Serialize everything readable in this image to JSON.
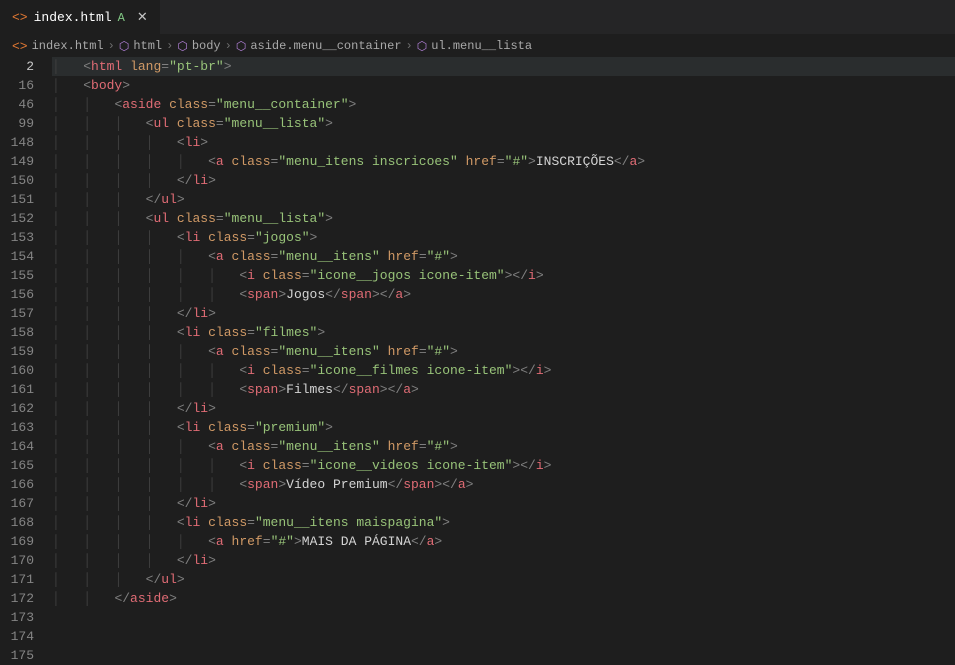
{
  "tab": {
    "filename": "index.html",
    "status": "A"
  },
  "breadcrumb": {
    "items": [
      "index.html",
      "html",
      "body",
      "aside.menu__container",
      "ul.menu__lista"
    ]
  },
  "editor": {
    "lines": [
      {
        "num": "2",
        "indent": 1,
        "html": "<span class='p1'>&lt;</span><span class='tg'>html</span> <span class='at'>lang</span><span class='p1'>=</span><span class='st'>\"pt-br\"</span><span class='p1'>&gt;</span>",
        "active": true
      },
      {
        "num": "16",
        "indent": 1,
        "html": "<span class='p1'>&lt;</span><span class='tg'>body</span><span class='p1'>&gt;</span>"
      },
      {
        "num": "46",
        "indent": 2,
        "html": "<span class='p1'>&lt;</span><span class='tg'>aside</span> <span class='at'>class</span><span class='p1'>=</span><span class='st'>\"menu__container\"</span><span class='p1'>&gt;</span>"
      },
      {
        "num": "99",
        "indent": 3,
        "html": "<span class='p1'>&lt;</span><span class='tg'>ul</span> <span class='at'>class</span><span class='p1'>=</span><span class='st'>\"menu__lista\"</span><span class='p1'>&gt;</span>"
      },
      {
        "num": "148",
        "indent": 4,
        "html": "<span class='p1'>&lt;</span><span class='tg'>li</span><span class='p1'>&gt;</span>"
      },
      {
        "num": "149",
        "indent": 5,
        "html": "<span class='p1'>&lt;</span><span class='tg'>a</span> <span class='at'>class</span><span class='p1'>=</span><span class='st'>\"menu_itens inscricoes\"</span> <span class='at'>href</span><span class='p1'>=</span><span class='st'>\"#\"</span><span class='p1'>&gt;</span><span class='tx'>INSCRIÇÕES</span><span class='p1'>&lt;/</span><span class='tg'>a</span><span class='p1'>&gt;</span>"
      },
      {
        "num": "150",
        "indent": 4,
        "html": "<span class='p1'>&lt;/</span><span class='tg'>li</span><span class='p1'>&gt;</span>"
      },
      {
        "num": "151",
        "indent": 3,
        "html": "<span class='p1'>&lt;/</span><span class='tg'>ul</span><span class='p1'>&gt;</span>"
      },
      {
        "num": "152",
        "indent": 0,
        "html": ""
      },
      {
        "num": "153",
        "indent": 3,
        "html": "<span class='p1'>&lt;</span><span class='tg'>ul</span> <span class='at'>class</span><span class='p1'>=</span><span class='st'>\"menu__lista\"</span><span class='p1'>&gt;</span>"
      },
      {
        "num": "154",
        "indent": 4,
        "html": "<span class='p1'>&lt;</span><span class='tg'>li</span> <span class='at'>class</span><span class='p1'>=</span><span class='st'>\"jogos\"</span><span class='p1'>&gt;</span>"
      },
      {
        "num": "155",
        "indent": 5,
        "html": "<span class='p1'>&lt;</span><span class='tg'>a</span> <span class='at'>class</span><span class='p1'>=</span><span class='st'>\"menu__itens\"</span> <span class='at'>href</span><span class='p1'>=</span><span class='st'>\"#\"</span><span class='p1'>&gt;</span>"
      },
      {
        "num": "156",
        "indent": 6,
        "html": "<span class='p1'>&lt;</span><span class='tg'>i</span> <span class='at'>class</span><span class='p1'>=</span><span class='st'>\"icone__jogos icone-item\"</span><span class='p1'>&gt;&lt;/</span><span class='tg'>i</span><span class='p1'>&gt;</span>"
      },
      {
        "num": "157",
        "indent": 6,
        "html": "<span class='p1'>&lt;</span><span class='tg'>span</span><span class='p1'>&gt;</span><span class='tx'>Jogos</span><span class='p1'>&lt;/</span><span class='tg'>span</span><span class='p1'>&gt;&lt;/</span><span class='tg'>a</span><span class='p1'>&gt;</span>"
      },
      {
        "num": "158",
        "indent": 4,
        "html": "<span class='p1'>&lt;/</span><span class='tg'>li</span><span class='p1'>&gt;</span>"
      },
      {
        "num": "159",
        "indent": 0,
        "html": ""
      },
      {
        "num": "160",
        "indent": 4,
        "html": "<span class='p1'>&lt;</span><span class='tg'>li</span> <span class='at'>class</span><span class='p1'>=</span><span class='st'>\"filmes\"</span><span class='p1'>&gt;</span>"
      },
      {
        "num": "161",
        "indent": 5,
        "html": "<span class='p1'>&lt;</span><span class='tg'>a</span> <span class='at'>class</span><span class='p1'>=</span><span class='st'>\"menu__itens\"</span> <span class='at'>href</span><span class='p1'>=</span><span class='st'>\"#\"</span><span class='p1'>&gt;</span>"
      },
      {
        "num": "162",
        "indent": 6,
        "html": "<span class='p1'>&lt;</span><span class='tg'>i</span> <span class='at'>class</span><span class='p1'>=</span><span class='st'>\"icone__filmes icone-item\"</span><span class='p1'>&gt;&lt;/</span><span class='tg'>i</span><span class='p1'>&gt;</span>"
      },
      {
        "num": "163",
        "indent": 6,
        "html": "<span class='p1'>&lt;</span><span class='tg'>span</span><span class='p1'>&gt;</span><span class='tx'>Filmes</span><span class='p1'>&lt;/</span><span class='tg'>span</span><span class='p1'>&gt;&lt;/</span><span class='tg'>a</span><span class='p1'>&gt;</span>"
      },
      {
        "num": "164",
        "indent": 4,
        "html": "<span class='p1'>&lt;/</span><span class='tg'>li</span><span class='p1'>&gt;</span>"
      },
      {
        "num": "165",
        "indent": 4,
        "html": "<span class='p1'>&lt;</span><span class='tg'>li</span> <span class='at'>class</span><span class='p1'>=</span><span class='st'>\"premium\"</span><span class='p1'>&gt;</span>"
      },
      {
        "num": "166",
        "indent": 5,
        "html": "<span class='p1'>&lt;</span><span class='tg'>a</span> <span class='at'>class</span><span class='p1'>=</span><span class='st'>\"menu__itens\"</span> <span class='at'>href</span><span class='p1'>=</span><span class='st'>\"#\"</span><span class='p1'>&gt;</span>"
      },
      {
        "num": "167",
        "indent": 6,
        "html": "<span class='p1'>&lt;</span><span class='tg'>i</span> <span class='at'>class</span><span class='p1'>=</span><span class='st'>\"icone__videos icone-item\"</span><span class='p1'>&gt;&lt;/</span><span class='tg'>i</span><span class='p1'>&gt;</span>"
      },
      {
        "num": "168",
        "indent": 6,
        "html": "<span class='p1'>&lt;</span><span class='tg'>span</span><span class='p1'>&gt;</span><span class='tx'>Vídeo Premium</span><span class='p1'>&lt;/</span><span class='tg'>span</span><span class='p1'>&gt;&lt;/</span><span class='tg'>a</span><span class='p1'>&gt;</span>"
      },
      {
        "num": "169",
        "indent": 4,
        "html": "<span class='p1'>&lt;/</span><span class='tg'>li</span><span class='p1'>&gt;</span>"
      },
      {
        "num": "170",
        "indent": 0,
        "html": ""
      },
      {
        "num": "171",
        "indent": 4,
        "html": "<span class='p1'>&lt;</span><span class='tg'>li</span> <span class='at'>class</span><span class='p1'>=</span><span class='st'>\"menu__itens maispagina\"</span><span class='p1'>&gt;</span>"
      },
      {
        "num": "172",
        "indent": 5,
        "html": "<span class='p1'>&lt;</span><span class='tg'>a</span> <span class='at'>href</span><span class='p1'>=</span><span class='st'>\"#\"</span><span class='p1'>&gt;</span><span class='tx'>MAIS DA PÁGINA</span><span class='p1'>&lt;/</span><span class='tg'>a</span><span class='p1'>&gt;</span>"
      },
      {
        "num": "173",
        "indent": 4,
        "html": "<span class='p1'>&lt;/</span><span class='tg'>li</span><span class='p1'>&gt;</span>"
      },
      {
        "num": "174",
        "indent": 3,
        "html": "<span class='p1'>&lt;/</span><span class='tg'>ul</span><span class='p1'>&gt;</span>"
      },
      {
        "num": "175",
        "indent": 2,
        "html": "<span class='p1'>&lt;/</span><span class='tg'>aside</span><span class='p1'>&gt;</span>"
      }
    ]
  }
}
